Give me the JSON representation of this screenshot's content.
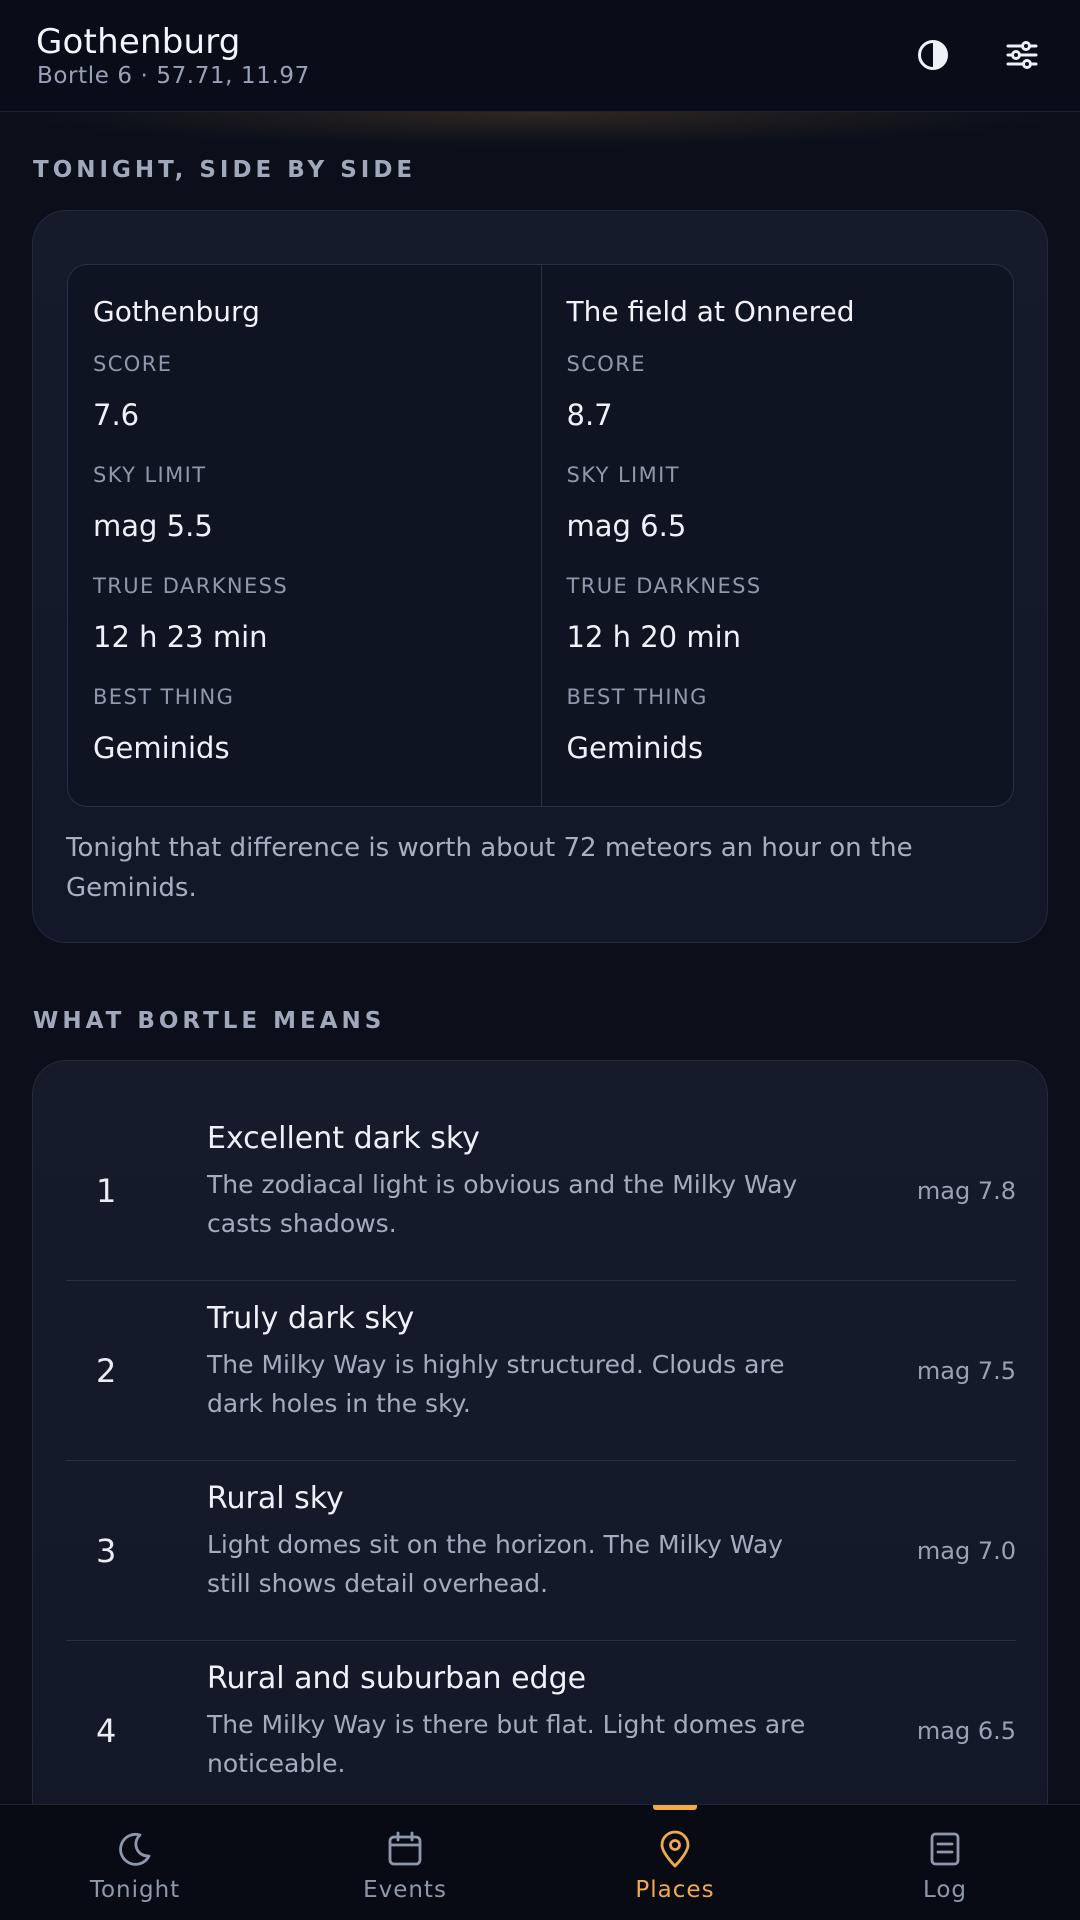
{
  "header": {
    "title": "Gothenburg",
    "subtitle": "Bortle 6 · 57.71, 11.97",
    "icons": {
      "contrast": "contrast-icon",
      "settings": "tune-icon"
    }
  },
  "compare": {
    "section_label": "TONIGHT, SIDE BY SIDE",
    "places": [
      {
        "name": "Gothenburg",
        "score_label": "SCORE",
        "score": "7.6",
        "sky_limit_label": "SKY LIMIT",
        "sky_limit": "mag 5.5",
        "darkness_label": "TRUE DARKNESS",
        "darkness": "12 h 23 min",
        "best_label": "BEST THING",
        "best": "Geminids"
      },
      {
        "name": "The field at Onnered",
        "score_label": "SCORE",
        "score": "8.7",
        "sky_limit_label": "SKY LIMIT",
        "sky_limit": "mag 6.5",
        "darkness_label": "TRUE DARKNESS",
        "darkness": "12 h 20 min",
        "best_label": "BEST THING",
        "best": "Geminids"
      }
    ],
    "note": "Tonight that difference is worth about 72 meteors an hour on the Geminids."
  },
  "bortle": {
    "section_label": "WHAT BORTLE MEANS",
    "rows": [
      {
        "num": "1",
        "title": "Excellent dark sky",
        "desc": "The zodiacal light is obvious and the Milky Way casts shadows.",
        "mag": "mag 7.8"
      },
      {
        "num": "2",
        "title": "Truly dark sky",
        "desc": "The Milky Way is highly structured. Clouds are dark holes in the sky.",
        "mag": "mag 7.5"
      },
      {
        "num": "3",
        "title": "Rural sky",
        "desc": "Light domes sit on the horizon. The Milky Way still shows detail overhead.",
        "mag": "mag 7.0"
      },
      {
        "num": "4",
        "title": "Rural and suburban edge",
        "desc": "The Milky Way is there but flat. Light domes are noticeable.",
        "mag": "mag 6.5"
      }
    ]
  },
  "nav": {
    "items": [
      {
        "label": "Tonight",
        "icon": "moon-icon"
      },
      {
        "label": "Events",
        "icon": "calendar-icon"
      },
      {
        "label": "Places",
        "icon": "map-pin-icon",
        "active": true
      },
      {
        "label": "Log",
        "icon": "notes-icon"
      }
    ],
    "active_color": "#f2a94a",
    "inactive_color": "#8f98ab"
  }
}
